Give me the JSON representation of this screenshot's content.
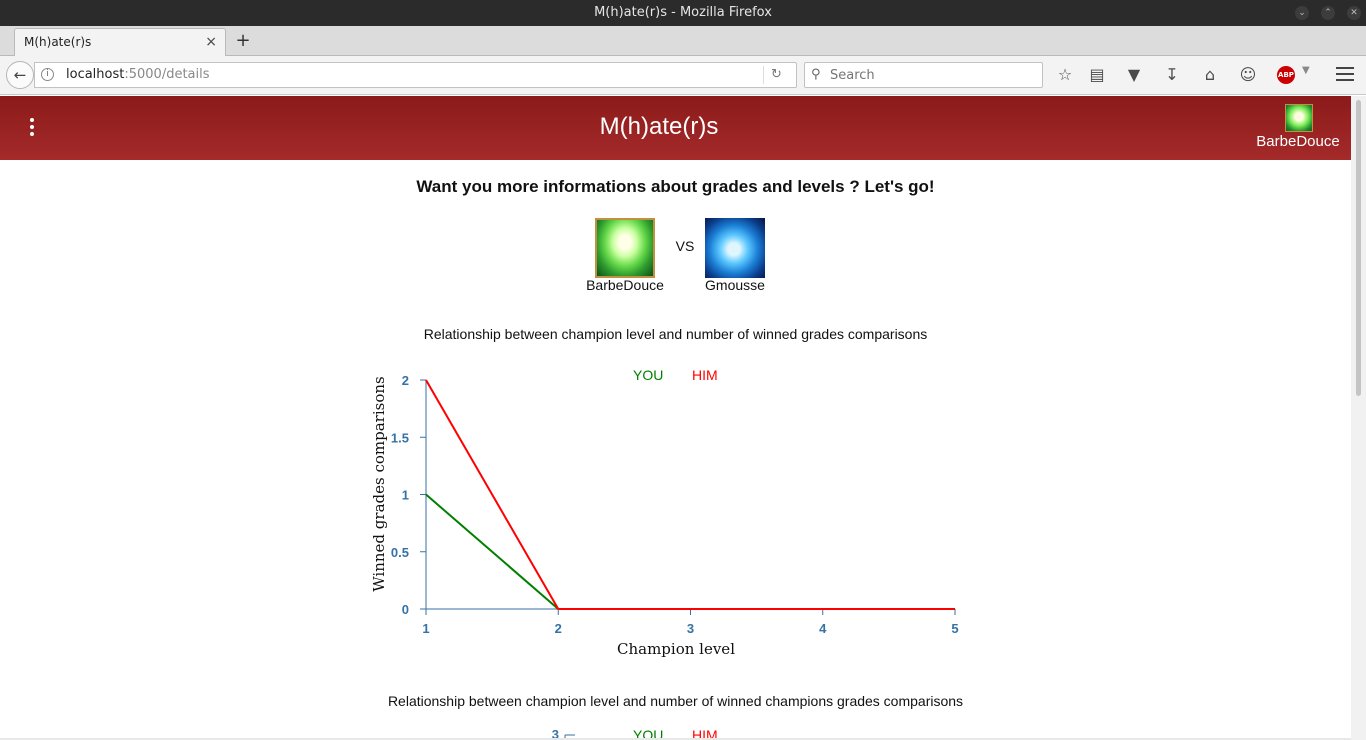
{
  "window": {
    "title": "M(h)ate(r)s - Mozilla Firefox"
  },
  "tab": {
    "label": "M(h)ate(r)s",
    "close": "×"
  },
  "new_tab": "+",
  "url": {
    "host": "localhost",
    "path": ":5000/details"
  },
  "search": {
    "placeholder": "Search"
  },
  "toolbar_icons": [
    "star-icon",
    "reading-list-icon",
    "pocket-icon",
    "download-icon",
    "home-icon",
    "chat-icon",
    "adblock-plus-icon",
    "menu-icon"
  ],
  "abp_label": "ABP",
  "app": {
    "title": "M(h)ate(r)s",
    "user": "BarbeDouce"
  },
  "page": {
    "headline": "Want you more informations about grades and levels ? Let's go!",
    "vs": "VS",
    "you_name": "BarbeDouce",
    "him_name": "Gmousse",
    "chart1_title": "Relationship between champion level and number of winned grades comparisons",
    "chart2_title": "Relationship between champion level and number of winned champions grades comparisons"
  },
  "colors": {
    "you": "#008000",
    "him": "#ff0000",
    "header": "#a52a2a",
    "axis": "#3572a5"
  },
  "chart_data": [
    {
      "type": "line",
      "title": "Relationship between champion level and number of winned grades comparisons",
      "xlabel": "Champion level",
      "ylabel": "Winned grades comparisons",
      "x": [
        1,
        2,
        3,
        4,
        5
      ],
      "xlim": [
        1,
        5
      ],
      "ylim": [
        0,
        2
      ],
      "yticks": [
        0,
        0.5,
        1,
        1.5,
        2
      ],
      "legend": "top",
      "series": [
        {
          "name": "YOU",
          "color": "#008000",
          "values": [
            1,
            0,
            0,
            0,
            0
          ]
        },
        {
          "name": "HIM",
          "color": "#ff0000",
          "values": [
            2,
            0,
            0,
            0,
            0
          ]
        }
      ]
    },
    {
      "type": "line",
      "title": "Relationship between champion level and number of winned champions grades comparisons",
      "yticks_visible": [
        "3"
      ],
      "legend_visible": [
        "YOU",
        "HIM"
      ]
    }
  ]
}
